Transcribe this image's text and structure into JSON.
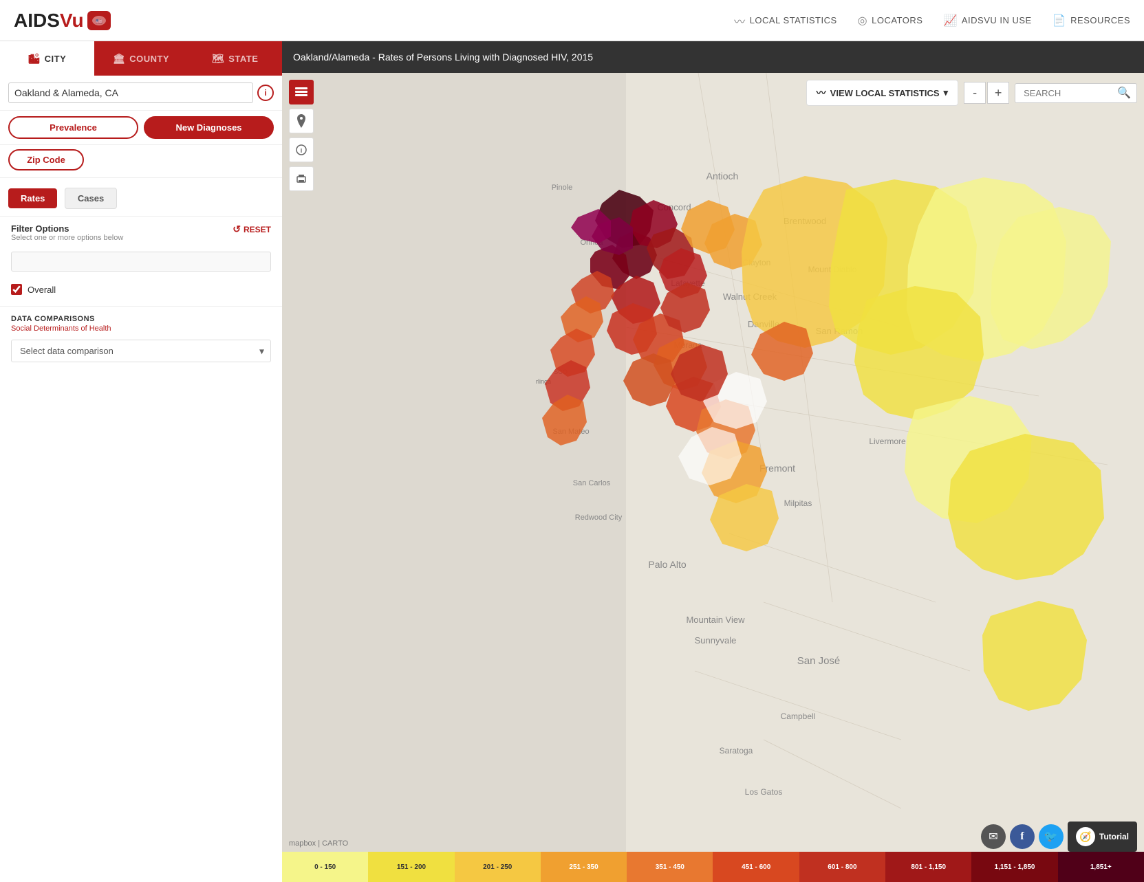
{
  "header": {
    "logo_text_normal": "AIDS",
    "logo_text_colored": "Vu",
    "nav_items": [
      {
        "id": "local-stats",
        "icon": "📊",
        "label": "LOCAL STATISTICS"
      },
      {
        "id": "locators",
        "icon": "📍",
        "label": "LOCATORS"
      },
      {
        "id": "aidsvu-in-use",
        "icon": "📈",
        "label": "AIDSVU IN USE"
      },
      {
        "id": "resources",
        "icon": "📄",
        "label": "RESOURCES"
      }
    ]
  },
  "sidebar": {
    "tabs": [
      {
        "id": "city",
        "icon": "🏙",
        "label": "CITY",
        "active": true
      },
      {
        "id": "county",
        "icon": "🏛",
        "label": "COUNTY",
        "active": false
      },
      {
        "id": "state",
        "icon": "🗺",
        "label": "STATE",
        "active": false
      }
    ],
    "location_value": "Oakland & Alameda, CA",
    "location_placeholder": "Oakland & Alameda, CA",
    "data_types": [
      {
        "id": "prevalence",
        "label": "Prevalence",
        "active": true
      },
      {
        "id": "new-diagnoses",
        "label": "New Diagnoses",
        "active": false
      }
    ],
    "zip_code_label": "Zip Code",
    "rates_cases": [
      {
        "id": "rates",
        "label": "Rates",
        "active": true
      },
      {
        "id": "cases",
        "label": "Cases",
        "active": false
      }
    ],
    "filter_options": {
      "title": "Filter Options",
      "subtitle": "Select one or more options below",
      "reset_label": "RESET",
      "search_placeholder": ""
    },
    "overall_label": "Overall",
    "data_comparisons": {
      "title": "DATA COMPARISONS",
      "subtitle": "Social Determinants of Health",
      "placeholder": "Select data comparison"
    }
  },
  "map": {
    "header_text": "Oakland/Alameda - Rates of Persons Living with Diagnosed HIV, 2015",
    "view_local_label": "VIEW LOCAL STATISTICS",
    "search_placeholder": "SEARCH",
    "zoom_in": "+",
    "zoom_out": "-",
    "credit": "mapbox | CARTO"
  },
  "legend": [
    {
      "id": "0-150",
      "label": "0 - 150",
      "color": "#f5f58a"
    },
    {
      "id": "151-200",
      "label": "151 - 200",
      "color": "#f0e040"
    },
    {
      "id": "201-250",
      "label": "201 - 250",
      "color": "#f5c842"
    },
    {
      "id": "251-350",
      "label": "251 - 350",
      "color": "#f0a030"
    },
    {
      "id": "351-450",
      "label": "351 - 450",
      "color": "#e87830"
    },
    {
      "id": "451-600",
      "label": "451 - 600",
      "color": "#d84820"
    },
    {
      "id": "601-800",
      "label": "601 - 800",
      "color": "#c03020"
    },
    {
      "id": "801-1150",
      "label": "801 - 1,150",
      "color": "#a01818"
    },
    {
      "id": "1151-1850",
      "label": "1,151 - 1,850",
      "color": "#780810"
    },
    {
      "id": "1851plus",
      "label": "1,851+",
      "color": "#500018"
    }
  ],
  "social": {
    "email_icon": "✉",
    "facebook_icon": "f",
    "twitter_icon": "t",
    "tutorial_label": "Tutorial"
  }
}
